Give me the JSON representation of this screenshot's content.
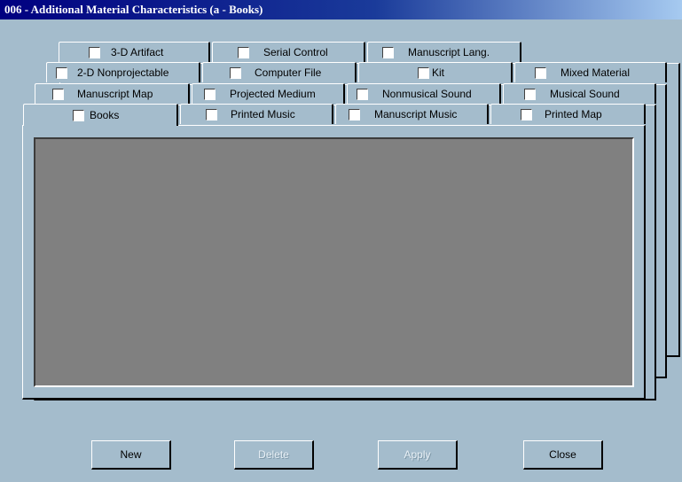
{
  "window": {
    "title": "006 - Additional Material Characteristics (a - Books)"
  },
  "tab_rows": [
    {
      "row": "row-1",
      "tabs": [
        {
          "id": "3d-artifact",
          "label": "3-D Artifact",
          "checked": false
        },
        {
          "id": "serial-control",
          "label": "Serial Control",
          "checked": false
        },
        {
          "id": "manuscript-lang",
          "label": "Manuscript Lang.",
          "checked": false
        }
      ]
    },
    {
      "row": "row-2",
      "tabs": [
        {
          "id": "2d-nonprojectable",
          "label": "2-D Nonprojectable",
          "checked": false
        },
        {
          "id": "computer-file",
          "label": "Computer File",
          "checked": false
        },
        {
          "id": "kit",
          "label": "Kit",
          "checked": false
        },
        {
          "id": "mixed-material",
          "label": "Mixed Material",
          "checked": false
        }
      ]
    },
    {
      "row": "row-3",
      "tabs": [
        {
          "id": "manuscript-map",
          "label": "Manuscript Map",
          "checked": false
        },
        {
          "id": "projected-medium",
          "label": "Projected Medium",
          "checked": false
        },
        {
          "id": "nonmusical-sound",
          "label": "Nonmusical Sound",
          "checked": false
        },
        {
          "id": "musical-sound",
          "label": "Musical Sound",
          "checked": false
        }
      ]
    },
    {
      "row": "row-4",
      "tabs": [
        {
          "id": "books",
          "label": "Books",
          "checked": false,
          "active": true
        },
        {
          "id": "printed-music",
          "label": "Printed Music",
          "checked": false
        },
        {
          "id": "manuscript-music",
          "label": "Manuscript Music",
          "checked": false
        },
        {
          "id": "printed-map",
          "label": "Printed Map",
          "checked": false
        }
      ]
    }
  ],
  "buttons": {
    "new": "New",
    "delete": "Delete",
    "apply": "Apply",
    "close": "Close"
  },
  "colors": {
    "dialog_background": "#a4bccc",
    "titlebar": "#000080",
    "content_area": "#808080"
  }
}
